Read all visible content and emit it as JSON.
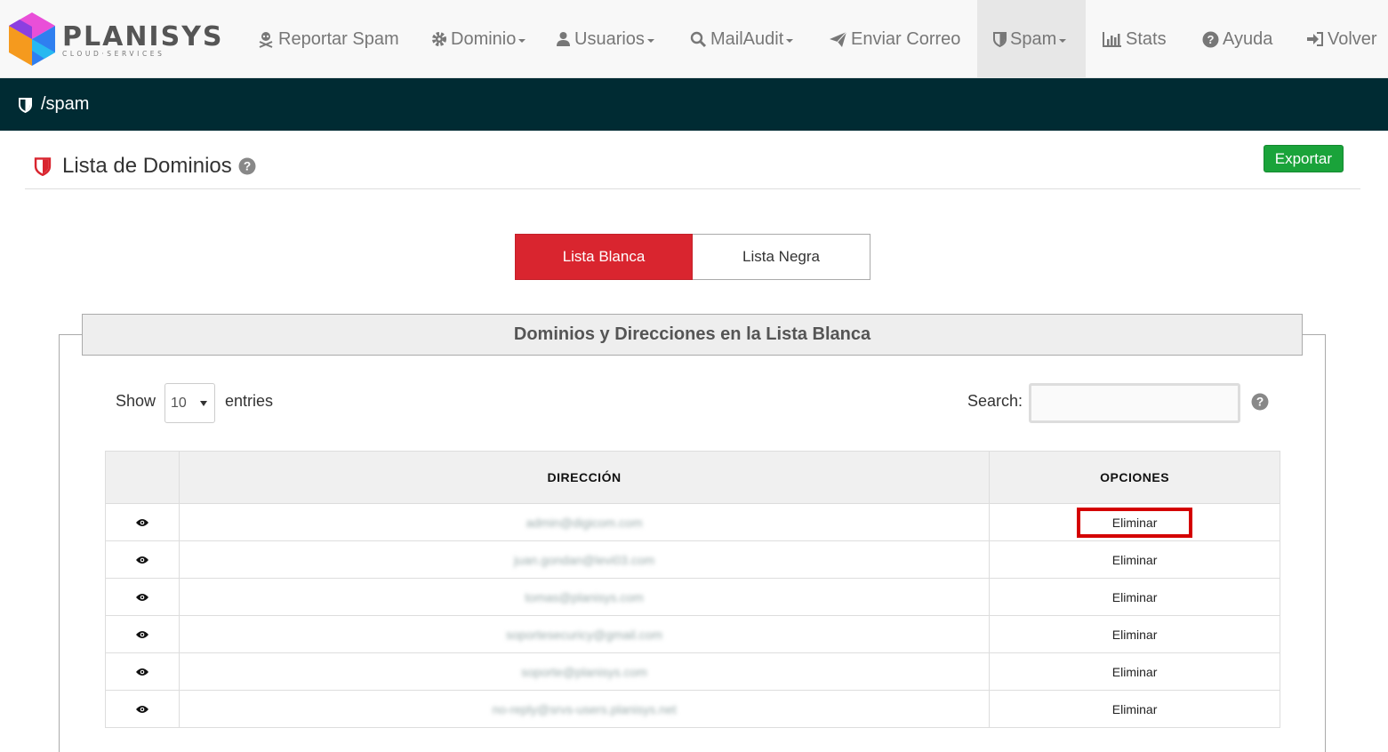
{
  "brand": {
    "name": "PLANISYS",
    "tagline": "CLOUD·SERVICES"
  },
  "nav": [
    {
      "label": "Reportar Spam",
      "icon": "skull-crossbones-icon",
      "dropdown": false
    },
    {
      "label": "Dominio",
      "icon": "gear-icon",
      "dropdown": true
    },
    {
      "label": "Usuarios",
      "icon": "user-icon",
      "dropdown": true
    },
    {
      "label": "MailAudit",
      "icon": "search-icon",
      "dropdown": true
    },
    {
      "label": "Enviar Correo",
      "icon": "paper-plane-icon",
      "dropdown": false
    },
    {
      "label": "Spam",
      "icon": "shield-icon",
      "dropdown": true,
      "active": true
    },
    {
      "label": "Stats",
      "icon": "bar-chart-icon",
      "dropdown": false
    },
    {
      "label": "Ayuda",
      "icon": "question-circle-icon",
      "dropdown": false
    },
    {
      "label": "Volver",
      "icon": "sign-in-icon",
      "dropdown": false
    }
  ],
  "breadcrumb": {
    "path": "/spam"
  },
  "header": {
    "title": "Lista de Dominios",
    "export_label": "Exportar"
  },
  "tabs": [
    {
      "label": "Lista Blanca",
      "active": true
    },
    {
      "label": "Lista Negra",
      "active": false
    }
  ],
  "panel": {
    "title": "Dominios y Direcciones en la Lista Blanca",
    "show_label": "Show",
    "page_size": "10",
    "entries_label": "entries",
    "search_label": "Search:",
    "search_value": ""
  },
  "table": {
    "columns": [
      "",
      "DIRECCIÓN",
      "OPCIONES"
    ],
    "rows": [
      {
        "address": "admin@digicom.com",
        "action": "Eliminar",
        "highlighted": true
      },
      {
        "address": "juan.gondan@levi03.com",
        "action": "Eliminar"
      },
      {
        "address": "tomas@planisys.com",
        "action": "Eliminar"
      },
      {
        "address": "soportesecuricy@gmail.com",
        "action": "Eliminar"
      },
      {
        "address": "soporte@planisys.com",
        "action": "Eliminar"
      },
      {
        "address": "no-reply@srvs-users.planisys.net",
        "action": "Eliminar"
      }
    ]
  },
  "colors": {
    "navbar_bg": "#f8f8f8",
    "crumb_bg": "#002b33",
    "accent_red": "#d9252f",
    "export_green": "#1aa33a",
    "highlight_red": "#d40000"
  }
}
